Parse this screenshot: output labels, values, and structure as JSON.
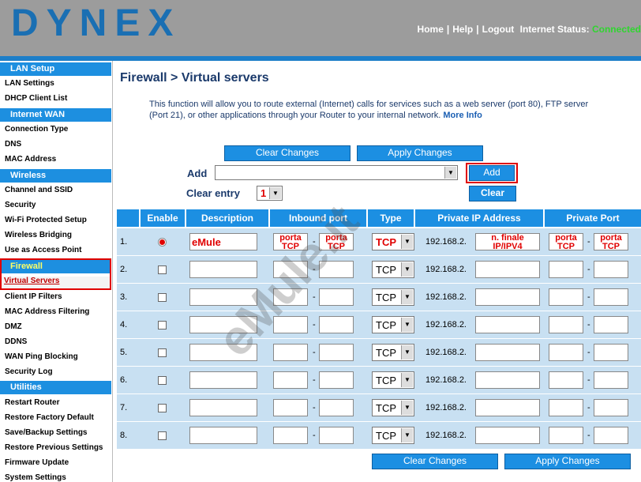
{
  "header": {
    "logo": "DYNEX",
    "nav": [
      "Home",
      "Help",
      "Logout"
    ],
    "status_label": "Internet Status:",
    "status_value": "Connected"
  },
  "sidebar": {
    "lan_setup": "LAN Setup",
    "lan_settings": "LAN Settings",
    "dhcp": "DHCP Client List",
    "internet_wan": "Internet WAN",
    "connection_type": "Connection Type",
    "dns": "DNS",
    "mac_address": "MAC Address",
    "wireless": "Wireless",
    "channel_ssid": "Channel and SSID",
    "security": "Security",
    "wps": "Wi-Fi Protected Setup",
    "bridging": "Wireless Bridging",
    "access_point": "Use as Access Point",
    "firewall": "Firewall",
    "virtual_servers": "Virtual Servers",
    "client_ip": "Client IP Filters",
    "mac_filter": "MAC Address Filtering",
    "dmz": "DMZ",
    "ddns": "DDNS",
    "wan_ping": "WAN Ping Blocking",
    "security_log": "Security Log",
    "utilities": "Utilities",
    "restart": "Restart Router",
    "restore_factory": "Restore Factory Default",
    "save_backup": "Save/Backup Settings",
    "restore_prev": "Restore Previous Settings",
    "firmware": "Firmware Update",
    "system": "System Settings"
  },
  "main": {
    "title": "Firewall > Virtual servers",
    "description": "This function will allow you to route external (Internet) calls for services such as a web server (port 80), FTP server (Port 21), or other applications through your Router to your internal network.",
    "more_info": "More Info",
    "clear_changes": "Clear Changes",
    "apply_changes": "Apply Changes",
    "add_label": "Add",
    "add_button": "Add",
    "clear_entry_label": "Clear entry",
    "clear_entry_value": "1",
    "clear_button": "Clear"
  },
  "table": {
    "headers": [
      "Enable",
      "Description",
      "Inbound port",
      "Type",
      "Private IP Address",
      "Private Port"
    ],
    "ip_prefix": "192.168.2.",
    "rows": [
      {
        "num": "1.",
        "desc": "eMule",
        "in1": "porta TCP",
        "in2": "porta TCP",
        "type": "TCP",
        "ip": "n. finale IP/IPV4",
        "pp1": "porta TCP",
        "pp2": "porta TCP"
      },
      {
        "num": "2.",
        "type": "TCP"
      },
      {
        "num": "3.",
        "type": "TCP"
      },
      {
        "num": "4.",
        "type": "TCP"
      },
      {
        "num": "5.",
        "type": "TCP"
      },
      {
        "num": "6.",
        "type": "TCP"
      },
      {
        "num": "7.",
        "type": "TCP"
      },
      {
        "num": "8.",
        "type": "TCP"
      }
    ]
  },
  "watermark": "eMule.it"
}
